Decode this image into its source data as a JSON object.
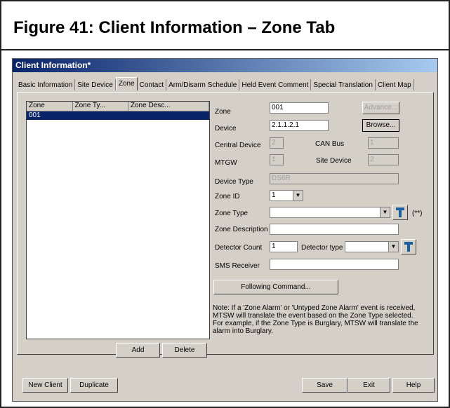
{
  "figure_title": "Figure 41:  Client Information – Zone Tab",
  "window_title": "Client Information*",
  "tabs": [
    "Basic Information",
    "Site Device",
    "Zone",
    "Contact",
    "Arm/Disarm Schedule",
    "Held Event Comment",
    "Special Translation",
    "Client Map"
  ],
  "list": {
    "columns": [
      "Zone",
      "Zone Ty...",
      "Zone Desc..."
    ],
    "rows": [
      [
        "001",
        "",
        ""
      ]
    ]
  },
  "labels": {
    "zone": "Zone",
    "device": "Device",
    "central_device": "Central Device",
    "can_bus": "CAN Bus",
    "mtgw": "MTGW",
    "site_device": "Site Device",
    "device_type": "Device Type",
    "zone_id": "Zone ID",
    "zone_type": "Zone Type",
    "zone_description": "Zone Description",
    "detector_count": "Detector Count",
    "detector_type": "Detector type",
    "sms_receiver": "SMS Receiver",
    "required_marker": "(**)"
  },
  "values": {
    "zone": "001",
    "device": "2.1.1.2.1",
    "central_device": "2",
    "can_bus": "1",
    "mtgw": "1",
    "site_device": "2",
    "device_type": "DS6R",
    "zone_id": "1",
    "zone_type": "",
    "zone_description": "",
    "detector_count": "1",
    "detector_type": "",
    "sms_receiver": ""
  },
  "buttons": {
    "advance": "Advance...",
    "browse": "Browse...",
    "following_command": "Following Command...",
    "add": "Add",
    "delete": "Delete",
    "new_client": "New Client",
    "duplicate": "Duplicate",
    "save": "Save",
    "exit": "Exit",
    "help": "Help"
  },
  "note": "Note: If a 'Zone Alarm' or 'Untyped Zone Alarm' event is received, MTSW will translate the event based on the Zone Type selected. For example, if the Zone Type is Burglary, MTSW will translate the alarm into Burglary."
}
